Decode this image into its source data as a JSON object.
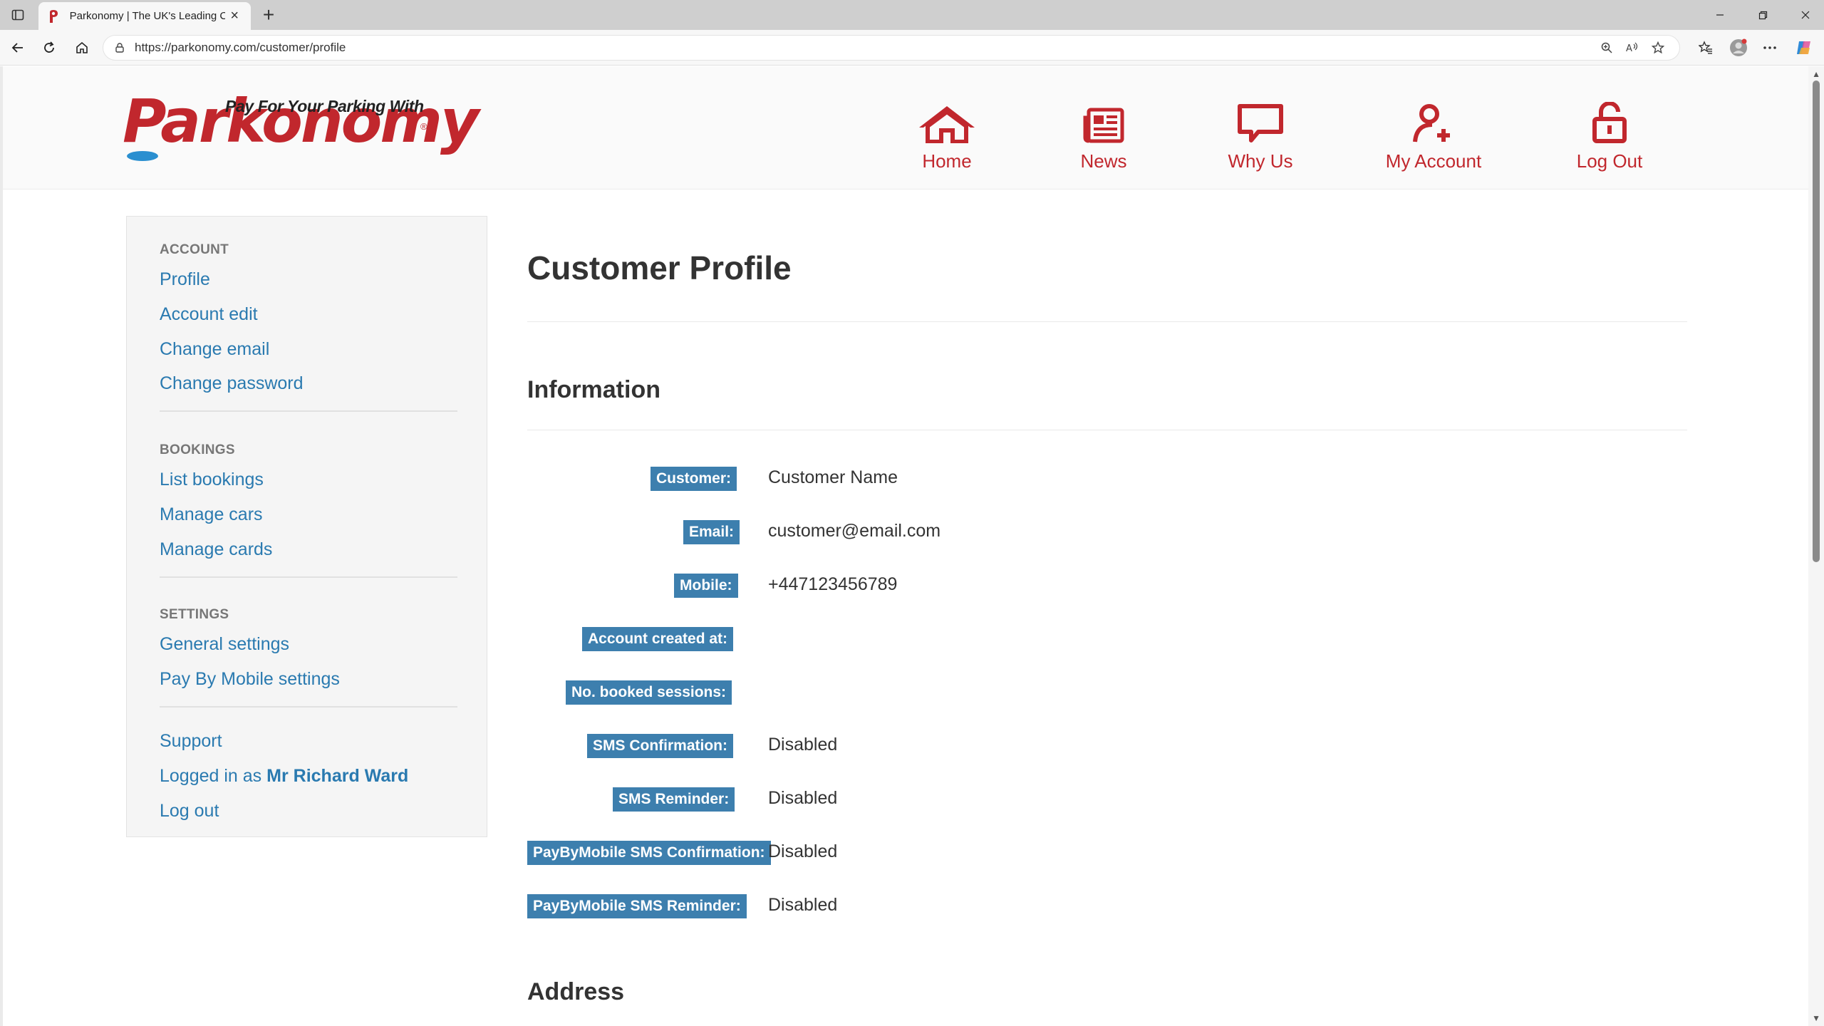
{
  "browser": {
    "tab_title": "Parkonomy | The UK's Leading Ca",
    "url": "https://parkonomy.com/customer/profile"
  },
  "header": {
    "logo_tagline": "Pay For Your Parking With",
    "logo_text": "Parkonomy",
    "logo_reg": "®",
    "nav": [
      {
        "label": "Home",
        "icon": "house-icon"
      },
      {
        "label": "News",
        "icon": "newspaper-icon"
      },
      {
        "label": "Why Us",
        "icon": "speech-bubble-icon"
      },
      {
        "label": "My Account",
        "icon": "user-add-icon"
      },
      {
        "label": "Log Out",
        "icon": "unlock-icon"
      }
    ],
    "accent_color": "#c1272d"
  },
  "sidebar": {
    "account_heading": "ACCOUNT",
    "account_links": [
      "Profile",
      "Account edit",
      "Change email",
      "Change password"
    ],
    "bookings_heading": "BOOKINGS",
    "bookings_links": [
      "List bookings",
      "Manage cars",
      "Manage cards"
    ],
    "settings_heading": "SETTINGS",
    "settings_links": [
      "General settings",
      "Pay By Mobile settings"
    ],
    "support": "Support",
    "logged_in_prefix": "Logged in as",
    "logged_in_user": "Mr Richard Ward",
    "log_out": "Log out"
  },
  "main": {
    "page_title": "Customer Profile",
    "information_title": "Information",
    "fields": [
      {
        "label": "Customer:",
        "value": "Customer Name"
      },
      {
        "label": "Email:",
        "value": "customer@email.com"
      },
      {
        "label": "Mobile:",
        "value": "+447123456789"
      },
      {
        "label": "Account created at:",
        "value": ""
      },
      {
        "label": "No. booked sessions:",
        "value": ""
      },
      {
        "label": "SMS Confirmation:",
        "value": "Disabled"
      },
      {
        "label": "SMS Reminder:",
        "value": "Disabled"
      },
      {
        "label": "PayByMobile SMS Confirmation:",
        "value": "Disabled"
      },
      {
        "label": "PayByMobile SMS Reminder:",
        "value": "Disabled"
      }
    ],
    "address_title": "Address",
    "label_color": "#3d7fae",
    "link_color": "#2a7ab0"
  }
}
